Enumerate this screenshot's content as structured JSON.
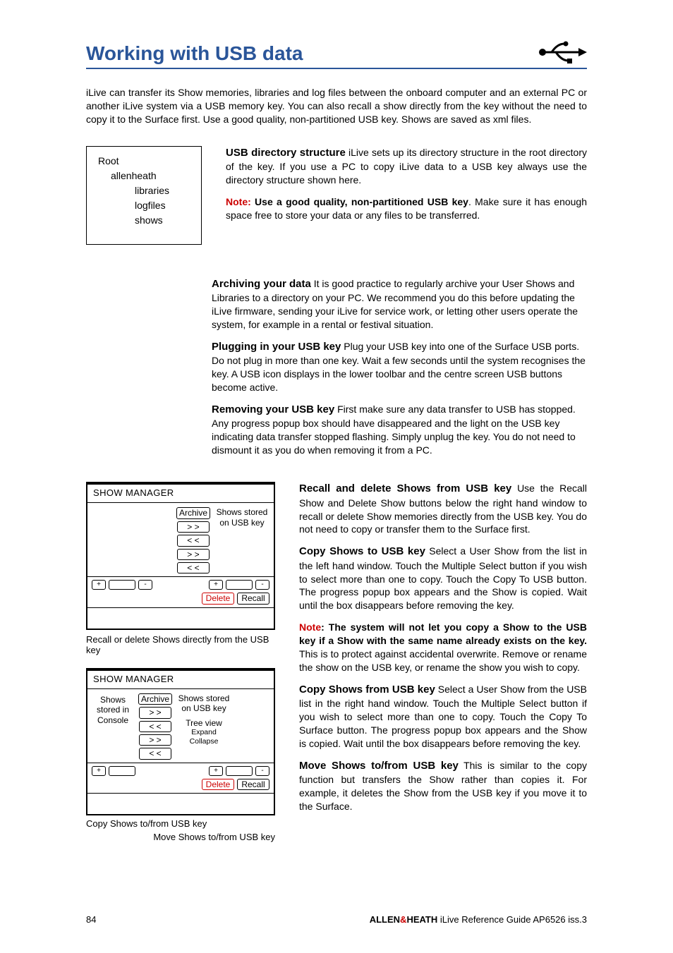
{
  "title": "Working with USB data",
  "intro": "iLive can transfer its Show memories, libraries and log files between the onboard computer and an external PC or another iLive system via a USB memory key.  You can also recall a show directly from the key without the need to copy it to the Surface first.  Use a good quality, non-partitioned USB key.  Shows are saved as xml files.",
  "dir": {
    "root": "Root",
    "l1": "allenheath",
    "l2a": "libraries",
    "l2b": "logfiles",
    "l2c": "shows"
  },
  "s1_lead": "USB directory structure",
  "s1_body": "   iLive sets up its directory structure in the root directory of the key.  If you use a PC to copy iLive data to a USB key always use the directory structure shown here.",
  "s1_note_lbl": "Note:",
  "s1_note_body1": "   Use a good quality, non-partitioned USB key",
  "s1_note_body2": ".  Make sure it has enough space free to store your data or any files to be transferred.",
  "s2_lead": "Archiving your data",
  "s2_body": "   It is good practice to regularly archive your User Shows and Libraries to a directory on your PC.  We recommend you do this before updating the iLive firmware, sending your iLive for service work, or letting other users operate the system, for example in a rental or festival situation.",
  "s3_lead": "Plugging in your USB key",
  "s3_body": "   Plug your USB key into one of the Surface USB ports.  Do not plug in more than one key.  Wait a few seconds until the system recognises the key.  A USB icon displays in the lower toolbar and the centre screen USB buttons become active.",
  "s4_lead": "Removing your USB key",
  "s4_body": "   First make sure any data transfer to USB has stopped.  Any progress popup box should have disappeared and the light on the USB key indicating data transfer stopped flashing.  Simply unplug the key.  You do not need to dismount it as you do when removing it from a PC.",
  "r1_lead": "Recall and delete Shows from USB key",
  "r1_body": "   Use the Recall Show and Delete Show buttons below the right hand window to recall or delete Show memories directly from the USB key.  You do not need to copy or transfer them to the Surface first.",
  "r2_lead": "Copy Shows to USB key",
  "r2_body": "   Select a User Show from the list in the left hand window.  Touch the Multiple Select button if you wish to select more than one to copy.  Touch the Copy To USB button.  The progress popup box appears and the Show is copied.  Wait until the box disappears before removing the key.",
  "r2_note_lbl": "Note",
  "r2_note_body1": ":   The system will not let you copy a Show to the USB key if a Show with the same name already exists on the key.",
  "r2_note_body2": "  This is to protect against accidental overwrite.  Remove or rename the show on the USB key, or rename the show you wish to copy.",
  "r3_lead": "Copy Shows from USB key",
  "r3_body": "   Select a User Show from the USB list in the right hand window.  Touch the Multiple Select button if you wish to select more than one to copy.  Touch the Copy To Surface button.  The progress popup box appears and the Show is copied.  Wait until the box disappears before removing the key.",
  "r4_lead": "Move Shows to/from USB key",
  "r4_body": "   This is similar to the copy function but transfers the Show rather than copies it.  For example, it deletes the Show from the USB key if you move it to the Surface.",
  "panel_title": "SHOW MANAGER",
  "btn_archive": "Archive",
  "btn_gt": "> >",
  "btn_lt": "< <",
  "btn_delete": "Delete",
  "btn_recall": "Recall",
  "info_usb": "Shows stored on USB key",
  "info_console": "Shows stored in Console",
  "info_tree": "Tree view",
  "info_expcol": "Expand Collapse",
  "caption1": "Recall or delete Shows directly from the USB key",
  "caption2a": "Copy Shows to/from USB key",
  "caption2b": "Move Shows to/from USB key",
  "footer_page": "84",
  "footer_brand1": "ALLEN",
  "footer_amp": "&",
  "footer_brand2": "HEATH",
  "footer_doc": " iLive  Reference Guide AP6526 iss.3",
  "sq_plus": "+",
  "sq_minus": "-"
}
